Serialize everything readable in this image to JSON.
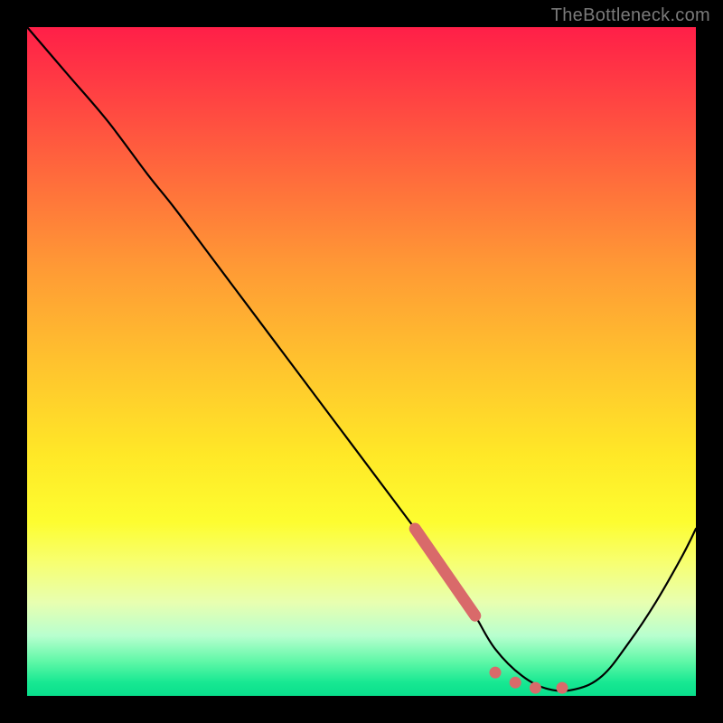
{
  "watermark": "TheBottleneck.com",
  "colors": {
    "accent_stroke": "#d96a6a",
    "curve_stroke": "#000000",
    "gradient_top": "#ff1f48",
    "gradient_bottom": "#09df8c"
  },
  "chart_data": {
    "type": "line",
    "title": "",
    "xlabel": "",
    "ylabel": "",
    "xlim": [
      0,
      100
    ],
    "ylim": [
      0,
      100
    ],
    "grid": false,
    "legend": false,
    "series": [
      {
        "name": "bottleneck-curve",
        "x": [
          0,
          6,
          12,
          18,
          22,
          28,
          34,
          40,
          46,
          52,
          58,
          64,
          67,
          70,
          74,
          78,
          82,
          86,
          90,
          94,
          98,
          100
        ],
        "y": [
          100,
          93,
          86,
          78,
          73,
          65,
          57,
          49,
          41,
          33,
          25,
          17,
          12,
          7,
          3,
          1,
          1,
          3,
          8,
          14,
          21,
          25
        ]
      }
    ],
    "accent_segment": {
      "name": "highlight",
      "x": [
        58,
        67
      ],
      "y": [
        25,
        12
      ]
    },
    "accent_dots": {
      "name": "valley-dots",
      "points": [
        {
          "x": 70,
          "y": 3.5
        },
        {
          "x": 73,
          "y": 2.0
        },
        {
          "x": 76,
          "y": 1.2
        },
        {
          "x": 80,
          "y": 1.2
        }
      ]
    }
  }
}
